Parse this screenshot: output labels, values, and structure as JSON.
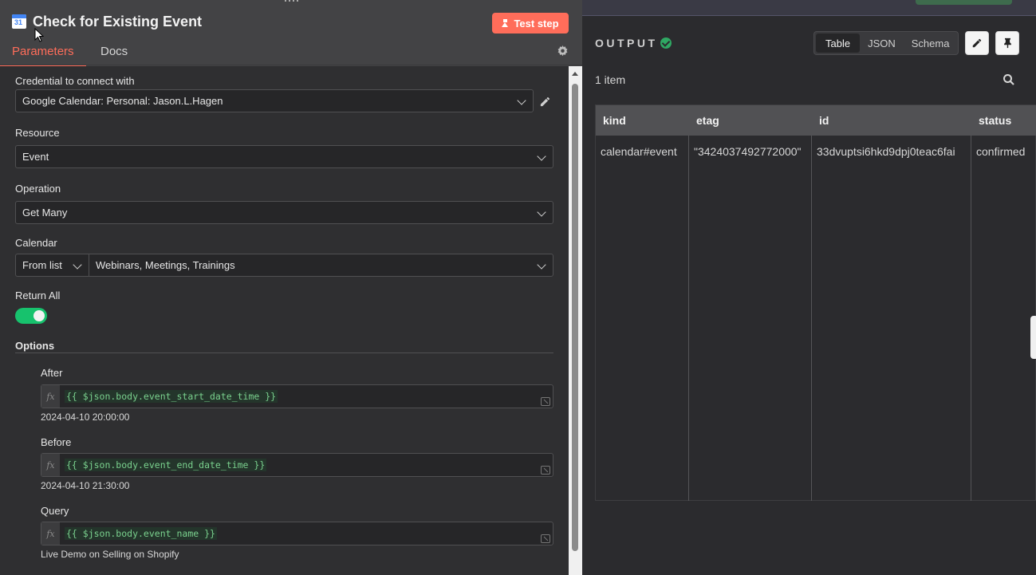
{
  "node": {
    "title": "Check for Existing Event",
    "test_button": "Test step",
    "tabs": [
      "Parameters",
      "Docs"
    ]
  },
  "params": {
    "credential": {
      "label": "Credential to connect with",
      "value": "Google Calendar: Personal: Jason.L.Hagen"
    },
    "resource": {
      "label": "Resource",
      "value": "Event"
    },
    "operation": {
      "label": "Operation",
      "value": "Get Many"
    },
    "calendar": {
      "label": "Calendar",
      "mode": "From list",
      "value": "Webinars, Meetings, Trainings"
    },
    "return_all": {
      "label": "Return All",
      "enabled": true
    },
    "options_label": "Options",
    "after": {
      "label": "After",
      "expr": "{{ $json.body.event_start_date_time }}",
      "result": "2024-04-10 20:00:00"
    },
    "before": {
      "label": "Before",
      "expr": "{{ $json.body.event_end_date_time }}",
      "result": "2024-04-10 21:30:00"
    },
    "query": {
      "label": "Query",
      "expr": "{{ $json.body.event_name }}",
      "result": "Live Demo on Selling on Shopify"
    }
  },
  "output": {
    "label": "OUTPUT",
    "views": [
      "Table",
      "JSON",
      "Schema"
    ],
    "selected_view": "Table",
    "count": "1 item",
    "columns": [
      "kind",
      "etag",
      "id",
      "status"
    ],
    "row": [
      "calendar#event",
      "\"3424037492772000\"",
      "33dvuptsi6hkd9dpj0teac6fai",
      "confirmed"
    ]
  },
  "colors": {
    "accent": "#ff6d5a",
    "success": "#17c26d"
  }
}
